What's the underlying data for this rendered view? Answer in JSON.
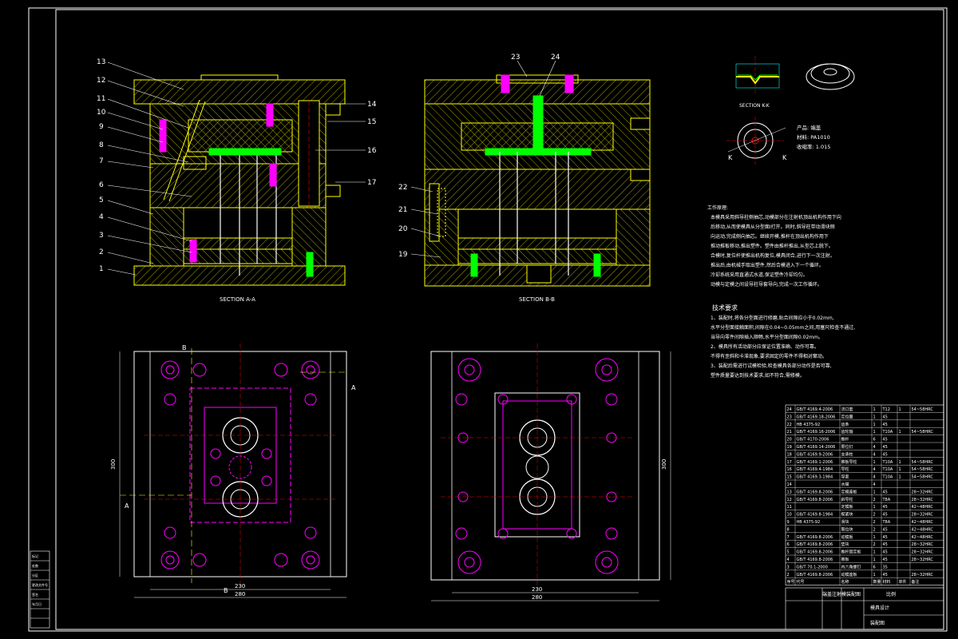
{
  "section_labels": {
    "a": "SECTION A-A",
    "b": "SECTION B-B",
    "k": "SECTION K-K"
  },
  "part_callouts_left": [
    "13",
    "12",
    "11",
    "10",
    "9",
    "8",
    "7",
    "6",
    "5",
    "4",
    "3",
    "2",
    "1"
  ],
  "part_callouts_right": [
    "14",
    "15",
    "16",
    "17"
  ],
  "part_callouts_b_top": [
    "23",
    "24"
  ],
  "part_callouts_b_left": [
    "22",
    "21",
    "20",
    "19"
  ],
  "cut_letters": {
    "b": "B",
    "a": "A",
    "k": "K"
  },
  "product_info": {
    "name": "产品: 端盖",
    "material": "材料: PA1010",
    "shrink": "收缩率: 1.015"
  },
  "work_process_title": "工作原理:",
  "work_process_lines": [
    "本模具采用斜导柱侧抽芯,动模部分在注射机顶出机构作用下向",
    "后移动,从而使模具从分型面I打开。同时,斜导柱带动滑块侧",
    "向运动,完成侧向抽芯。继续开模,推杆在顶出机构作用下",
    "推动推板移动,推出塑件。塑件由推杆推出,从型芯上脱下。",
    "合模时,复位杆使推出机构复位,模具闭合,进行下一次注射。",
    "推出后,由机械手取出塑件,然后合模进入下一个循环。",
    "冷却系统采用直通式水道,保证塑件冷却均匀。",
    "动模与定模之间设导柱导套导向,完成一次工作循环。"
  ],
  "tech_title": "技术要求",
  "tech_lines": [
    "1、装配时,将各分型面进行修磨,贴合间隙应小于0.02mm,",
    "水平分型面接触面积,间隙在0.04~0.05mm之间,用塞尺检查不通过,",
    "当导向零件间隙插入顺畅,水平分型面间隙0.02mm。",
    "2、模具所有活动部分应保证位置准确、动作可靠。",
    "不得有歪斜和卡滞现象,要求固定的零件不得相对窜动。",
    "3、装配后需进行试模检验,检查模具各部分动作是否可靠,",
    "塑件质量要达到技术要求,如不符合,需修模。"
  ],
  "bom_rows": [
    [
      "24",
      "GB/T 4169.4-2006",
      "浇口套",
      "1",
      "T12",
      "1",
      "54~58HRC"
    ],
    [
      "23",
      "GB/T 4169.18-2006",
      "定位圈",
      "1",
      "45",
      "",
      ""
    ],
    [
      "22",
      "HB 4375-92",
      "齿条",
      "1",
      "45",
      "",
      ""
    ],
    [
      "21",
      "GB/T 4169.16-2006",
      "齿轮轴",
      "1",
      "T10A",
      "1",
      "54~58HRC"
    ],
    [
      "20",
      "GB/T 4170-2006",
      "推杆",
      "6",
      "45",
      "",
      ""
    ],
    [
      "19",
      "GB/T 4169.14-2006",
      "限位钉",
      "4",
      "45",
      "",
      ""
    ],
    [
      "18",
      "GB/T 4169.9-2006",
      "支承柱",
      "4",
      "45",
      "",
      ""
    ],
    [
      "17",
      "GB/T 4169.1-2006",
      "推板导柱",
      "1",
      "T10A",
      "1",
      "54~58HRC"
    ],
    [
      "16",
      "GB/T 4169.4-1984",
      "导柱",
      "4",
      "T10A",
      "1",
      "54~58HRC"
    ],
    [
      "15",
      "GB/T 4169.3-1984",
      "导套",
      "4",
      "T10A",
      "1",
      "54~58HRC"
    ],
    [
      "14",
      "",
      "水嘴",
      "4",
      "",
      "",
      ""
    ],
    [
      "13",
      "GB/T 4169.8-2006",
      "定模座板",
      "1",
      "45",
      "",
      "28~32HRC"
    ],
    [
      "12",
      "GB/T 4169.8-2006",
      "斜导柱",
      "2",
      "T8A",
      "",
      "28~32HRC"
    ],
    [
      "11",
      "",
      "定模板",
      "1",
      "45",
      "",
      "42~48HRC"
    ],
    [
      "10",
      "GB/T 4169.8-1984",
      "楔紧块",
      "2",
      "45",
      "",
      "28~32HRC"
    ],
    [
      "9",
      "HB 4375-92",
      "滑块",
      "2",
      "T8A",
      "",
      "42~48HRC"
    ],
    [
      "8",
      "",
      "限位块",
      "2",
      "45",
      "",
      "42~48HRC"
    ],
    [
      "7",
      "GB/T 4169.8-2006",
      "动模板",
      "1",
      "45",
      "",
      "42~48HRC"
    ],
    [
      "6",
      "GB/T 4169.8-2006",
      "垫块",
      "2",
      "45",
      "",
      "28~32HRC"
    ],
    [
      "5",
      "GB/T 4169.8-2006",
      "推杆固定板",
      "1",
      "45",
      "",
      "28~32HRC"
    ],
    [
      "4",
      "GB/T 4169.8-2006",
      "推板",
      "1",
      "45",
      "",
      "28~32HRC"
    ],
    [
      "3",
      "GB/T 70.1-2000",
      "内六角螺钉",
      "6",
      "35",
      "",
      ""
    ],
    [
      "2",
      "GB/T 4169.8-2006",
      "动模座板",
      "1",
      "45",
      "",
      "28~32HRC"
    ]
  ],
  "bom_header": [
    "序号",
    "代号",
    "名称",
    "数量",
    "材料",
    "单件",
    "备注"
  ],
  "title_block": {
    "drawing_name": "端盖注射模装配图",
    "scale_label": "比例",
    "company": "模具设计",
    "sheet": "装配图"
  },
  "dimensions": {
    "width_inner": "230",
    "width_outer": "280",
    "height": "300"
  },
  "side_panel_labels": [
    "标记",
    "处数",
    "分区",
    "更改文件号",
    "签名",
    "年月日"
  ]
}
